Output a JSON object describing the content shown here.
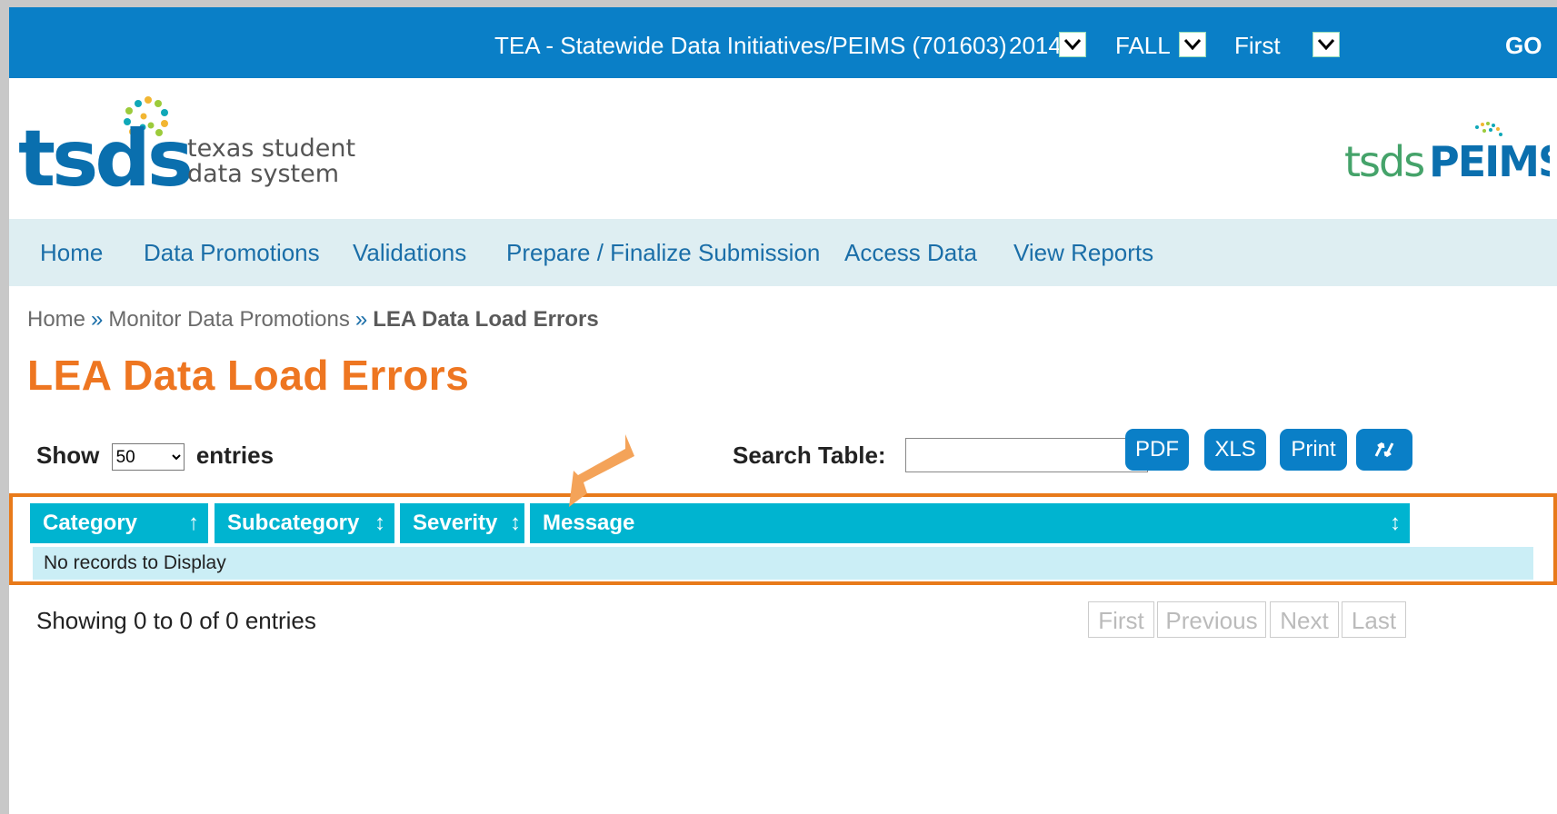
{
  "topbar": {
    "org": "TEA - Statewide Data Initiatives/PEIMS (701603)",
    "year": "2014",
    "term": "FALL",
    "submission": "First",
    "go_label": "GO"
  },
  "logo": {
    "brand": "tsds",
    "line1": "texas student",
    "line2": "data system",
    "peims_prefix": "tsds",
    "peims_suffix": "PEIMS"
  },
  "nav": [
    "Home",
    "Data Promotions",
    "Validations",
    "Prepare / Finalize Submission",
    "Access Data",
    "View Reports"
  ],
  "breadcrumb": {
    "home": "Home",
    "sep": "»",
    "mid": "Monitor Data Promotions",
    "current": "LEA Data Load Errors"
  },
  "page_title": "LEA Data Load Errors",
  "controls": {
    "show_label": "Show",
    "entries_value": "50",
    "entries_label": "entries",
    "search_label": "Search Table:",
    "search_value": "",
    "buttons": [
      "PDF",
      "XLS",
      "Print"
    ]
  },
  "table": {
    "columns": [
      "Category",
      "Subcategory",
      "Severity",
      "Message"
    ],
    "empty_message": "No records to Display"
  },
  "footer": {
    "showing": "Showing 0 to 0 of 0 entries",
    "pager": [
      "First",
      "Previous",
      "Next",
      "Last"
    ]
  },
  "colors": {
    "topbar": "#0a7fc7",
    "accent_orange": "#ee7621",
    "table_header": "#00b4d0",
    "nav_bg": "#deeef2"
  }
}
